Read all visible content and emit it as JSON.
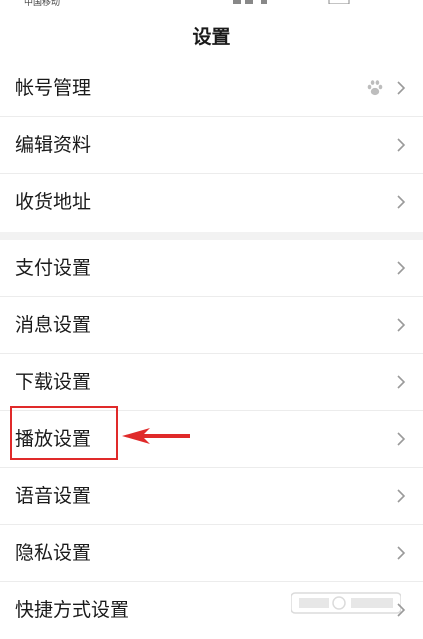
{
  "status_bar": {
    "carrier": "中国移动"
  },
  "header": {
    "title": "设置"
  },
  "groups": [
    {
      "items": [
        {
          "label": "帐号管理",
          "has_badge_icon": true
        },
        {
          "label": "编辑资料"
        },
        {
          "label": "收货地址"
        }
      ]
    },
    {
      "items": [
        {
          "label": "支付设置"
        },
        {
          "label": "消息设置"
        },
        {
          "label": "下载设置"
        },
        {
          "label": "播放设置",
          "highlighted": true
        },
        {
          "label": "语音设置"
        },
        {
          "label": "隐私设置"
        },
        {
          "label": "快捷方式设置"
        }
      ]
    }
  ],
  "annotation": {
    "box_color": "#e02a2a",
    "arrow_color": "#e02a2a"
  },
  "icons": {
    "row_chevron": "chevron-right-icon",
    "account_badge": "paw-icon"
  }
}
